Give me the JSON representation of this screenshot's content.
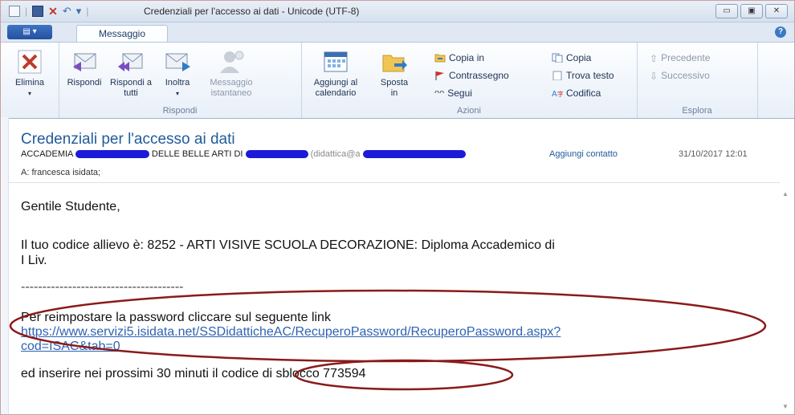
{
  "window": {
    "title": "Credenziali per l'accesso ai dati - Unicode (UTF-8)",
    "controls": {
      "minimize": "▭",
      "maximize": "▣",
      "close": "✕"
    }
  },
  "tabs": {
    "active": "Messaggio"
  },
  "ribbon": {
    "groups": {
      "elimina": {
        "label": "Elimina"
      },
      "rispondi": {
        "label": "Rispondi",
        "buttons": [
          "Rispondi",
          "Rispondi a tutti",
          "Inoltra",
          "Messaggio istantaneo"
        ]
      },
      "azioni": {
        "label": "Azioni",
        "big": [
          "Aggiungi al calendario",
          "Sposta in"
        ],
        "small": [
          "Copia in",
          "Contrassegno",
          "Segui",
          "Copia",
          "Trova testo",
          "Codifica"
        ]
      },
      "esplora": {
        "label": "Esplora",
        "buttons": [
          "Precedente",
          "Successivo"
        ]
      }
    }
  },
  "message": {
    "subject": "Credenziali per l'accesso ai dati",
    "from_prefix": "ACCADEMIA",
    "from_middle": "DELLE BELLE ARTI DI",
    "from_email_prefix": "(didattica@a",
    "add_contact": "Aggiungi contatto",
    "date": "31/10/2017 12:01",
    "to": "A: francesca isidata;"
  },
  "body": {
    "greeting": "Gentile Studente,",
    "line1": "Il tuo codice allievo è: 8252 - ARTI VISIVE SCUOLA  DECORAZIONE: Diploma Accademico di",
    "line2": "I Liv.",
    "divider": "--------------------------------------",
    "reset_text": "Per reimpostare la password cliccare sul seguente link",
    "reset_link_1": "https://www.servizi5.isidata.net/SSDidatticheAC/RecuperoPassword/RecuperoPassword.aspx?",
    "reset_link_2": "cod=ISAC&tab=0",
    "code_prefix": "ed inserire nei prossimi 30 minuti il ",
    "code_text": "codice di sblocco 773594"
  },
  "colors": {
    "accent": "#1f5b9a",
    "link": "#2e62b4",
    "annotation": "#8b1a1a",
    "redaction": "#1a1ad8"
  }
}
